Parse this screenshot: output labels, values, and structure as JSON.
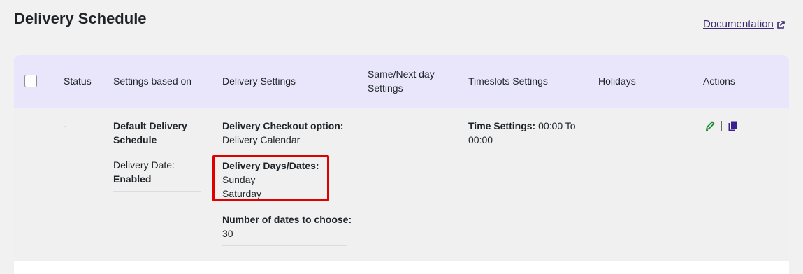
{
  "page": {
    "title": "Delivery Schedule",
    "doc_link": "Documentation"
  },
  "table": {
    "headers": {
      "status": "Status",
      "settings_based_on": "Settings based on",
      "delivery_settings": "Delivery Settings",
      "same_next_day_line1": "Same/Next day",
      "same_next_day_line2": "Settings",
      "timeslots": "Timeslots Settings",
      "holidays": "Holidays",
      "actions": "Actions"
    },
    "row": {
      "status": "-",
      "settings_name_line1": "Default Delivery",
      "settings_name_line2": "Schedule",
      "delivery_date_label": "Delivery Date:",
      "delivery_date_value": "Enabled",
      "checkout_option_label": "Delivery Checkout option:",
      "checkout_option_value": "Delivery Calendar",
      "days_label": "Delivery Days/Dates:",
      "day_1": "Sunday",
      "day_2": "Saturday",
      "dates_count_label": "Number of dates to choose:",
      "dates_count_value": "30",
      "time_settings_label": "Time Settings:",
      "time_settings_value_line1": "00:00 To",
      "time_settings_value_line2": "00:00"
    },
    "actions": {
      "edit_icon": "pencil-icon",
      "copy_icon": "copy-icon"
    }
  },
  "colors": {
    "header_bg": "#e9e6fb",
    "row_bg": "#f0f0f0",
    "highlight": "#e00000",
    "edit": "#1a8a3a",
    "copy": "#3d1f8f",
    "link": "#3c2a72"
  }
}
